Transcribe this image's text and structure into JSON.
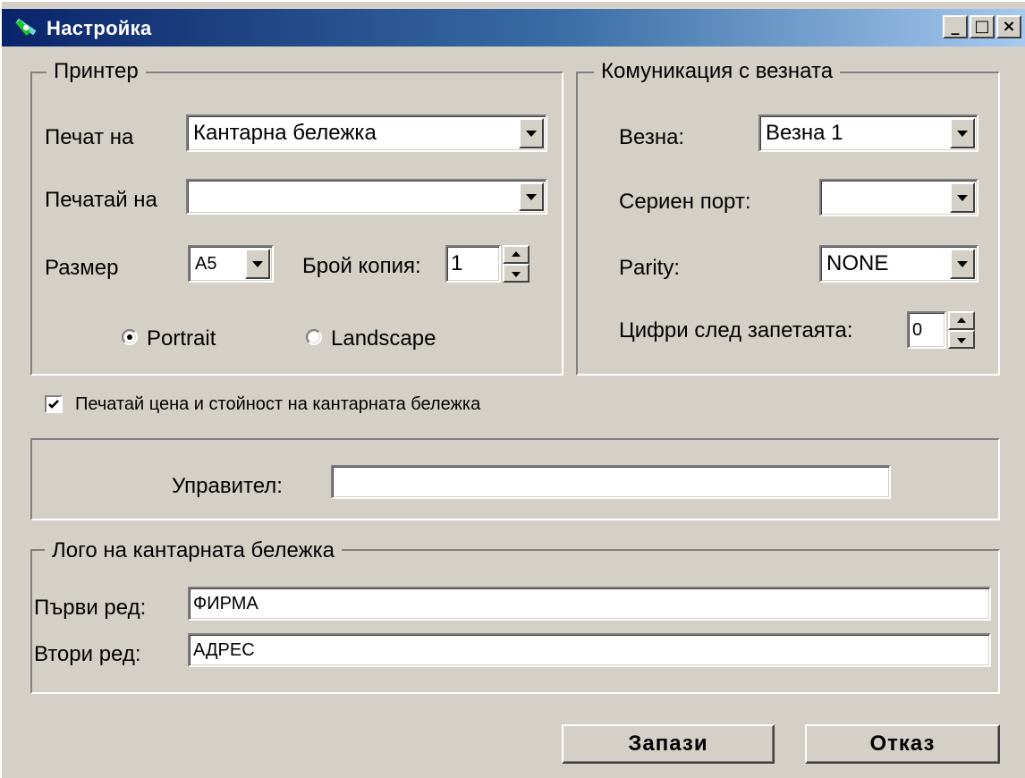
{
  "window": {
    "title": "Настройка",
    "minimize_glyph": "_",
    "maximize_glyph": "□",
    "close_glyph": "×"
  },
  "printer": {
    "legend": "Принтер",
    "print_on_label": "Печат на",
    "print_on_value": "Кантарна бележка",
    "printer_label": "Печатай на",
    "printer_value": "",
    "size_label": "Размер",
    "size_value": "A5",
    "copies_label": "Брой копия:",
    "copies_value": "1",
    "orientation": {
      "portrait_label": "Portrait",
      "landscape_label": "Landscape",
      "selected": "portrait"
    }
  },
  "scale": {
    "legend": "Комуникация с везната",
    "scale_label": "Везна:",
    "scale_value": "Везна 1",
    "port_label": "Сериен порт:",
    "port_value": "",
    "parity_label": "Parity:",
    "parity_value": "NONE",
    "decimals_label": "Цифри след запетаята:",
    "decimals_value": "0"
  },
  "print_price": {
    "label": "Печатай цена и стойност на кантарната бележка",
    "checked": true
  },
  "manager": {
    "label": "Управител:",
    "value": ""
  },
  "logo": {
    "legend": "Лого на кантарната бележка",
    "line1_label": "Първи ред:",
    "line1_value": "ФИРМА",
    "line2_label": "Втори ред:",
    "line2_value": "АДРЕС"
  },
  "buttons": {
    "save": "Запази",
    "cancel": "Отказ"
  },
  "colors": {
    "dialog_face": "#d4d0c8",
    "title_start": "#0a246a",
    "title_end": "#a6caf0"
  },
  "icons": {
    "app": "satellite-icon",
    "dropdown": "chevron-down-icon",
    "spin": "spin-arrows-icon"
  }
}
